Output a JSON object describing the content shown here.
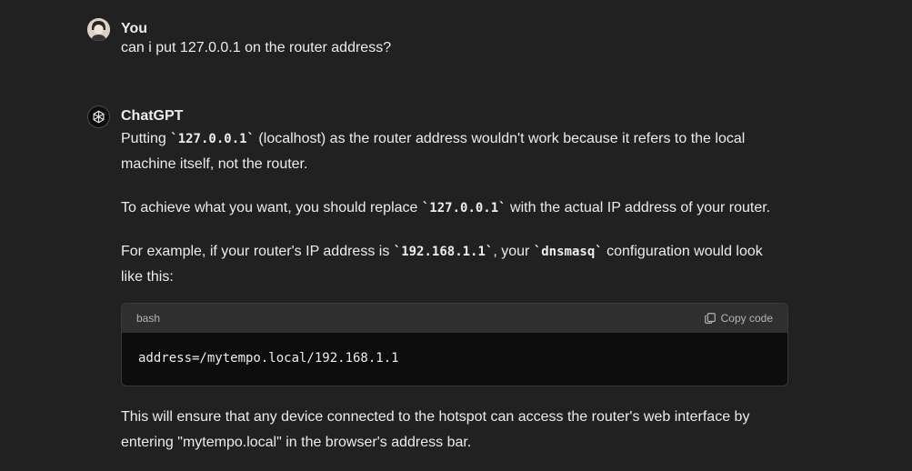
{
  "conversation": {
    "user_message": {
      "author": "You",
      "text": "can i put 127.0.0.1 on the router address?"
    },
    "assistant_message": {
      "author": "ChatGPT",
      "p1": {
        "before": "Putting ",
        "code": "`127.0.0.1`",
        "after": " (localhost) as the router address wouldn't work because it refers to the local machine itself, not the router."
      },
      "p2": {
        "before": "To achieve what you want, you should replace ",
        "code": "`127.0.0.1`",
        "after": " with the actual IP address of your router."
      },
      "p3": {
        "before": "For example, if your router's IP address is ",
        "code1": "`192.168.1.1`",
        "middle": ", your ",
        "code2": "`dnsmasq`",
        "after": " configuration would look like this:"
      },
      "code_block": {
        "language": "bash",
        "copy_label": "Copy code",
        "content": "address=/mytempo.local/192.168.1.1"
      },
      "p4": "This will ensure that any device connected to the hotspot can access the router's web interface by entering \"mytempo.local\" in the browser's address bar."
    }
  },
  "icons": {
    "user_avatar": "user-avatar",
    "assistant_avatar": "openai-logo-icon",
    "copy": "copy-icon"
  }
}
